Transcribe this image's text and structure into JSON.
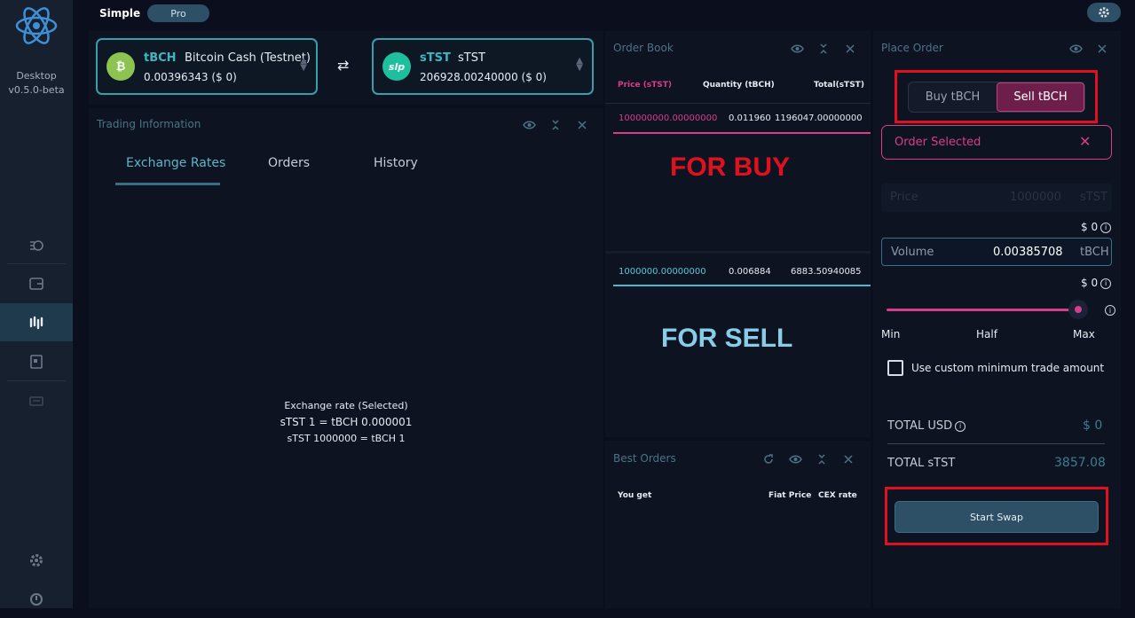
{
  "sidebar": {
    "app_name": "Desktop",
    "version": "v0.5.0-beta",
    "items": [
      {
        "icon": "dashboard-icon"
      },
      {
        "icon": "wallet-icon"
      },
      {
        "icon": "dex-icon"
      },
      {
        "icon": "addressbook-icon"
      },
      {
        "icon": "fiat-icon"
      }
    ],
    "bottom": [
      {
        "icon": "settings-icon"
      },
      {
        "icon": "support-icon"
      }
    ]
  },
  "header": {
    "mode_simple": "Simple",
    "mode_pro": "Pro"
  },
  "tickers": {
    "left": {
      "symbol": "tBCH",
      "name": "Bitcoin Cash (Testnet)",
      "balance": "0.00396343  ($ 0)",
      "color": "#8dc351"
    },
    "right": {
      "symbol": "sTST",
      "name": "sTST",
      "balance": "206928.00240000  ($ 0)",
      "color": "#1ebf9f",
      "icon_text": "slp"
    }
  },
  "trading_info": {
    "title": "Trading Information",
    "tabs": [
      "Exchange Rates",
      "Orders",
      "History"
    ],
    "rate_title": "Exchange rate (Selected)",
    "rate_line1": "sTST 1 = tBCH 0.000001",
    "rate_line2": "sTST 1000000 = tBCH 1"
  },
  "order_book": {
    "title": "Order Book",
    "headers": {
      "price": "Price (sTST)",
      "quantity": "Quantity (tBCH)",
      "total": "Total(sTST)"
    },
    "asks": [
      {
        "price": "100000000.00000000",
        "quantity": "0.011960",
        "total": "1196047.00000000"
      }
    ],
    "bids": [
      {
        "price": "1000000.00000000",
        "quantity": "0.006884",
        "total": "6883.50940085"
      }
    ],
    "for_buy_label": "FOR BUY",
    "for_sell_label": "FOR SELL"
  },
  "best_orders": {
    "title": "Best Orders",
    "headers": {
      "you_get": "You get",
      "fiat": "Fiat Price",
      "cex": "CEX rate"
    }
  },
  "place_order": {
    "title": "Place Order",
    "buy_label": "Buy tBCH",
    "sell_label": "Sell tBCH",
    "order_selected": "Order Selected",
    "price_label": "Price",
    "price_value": "1000000",
    "price_unit": "sTST",
    "price_usd": "$ 0",
    "volume_label": "Volume",
    "volume_value": "0.00385708",
    "volume_unit": "tBCH",
    "volume_usd": "$ 0",
    "slider_fraction": 1.0,
    "slider_min": "Min",
    "slider_half": "Half",
    "slider_max": "Max",
    "custom_min_label": "Use custom minimum trade amount",
    "total_usd_label": "TOTAL USD",
    "total_usd_value": "$ 0",
    "total_stst_label": "TOTAL sTST",
    "total_stst_value": "3857.08",
    "start_swap": "Start Swap"
  },
  "colors": {
    "accent": "#3fb6c4",
    "sell": "#d63d8a",
    "highlight_red": "#e0101e"
  }
}
